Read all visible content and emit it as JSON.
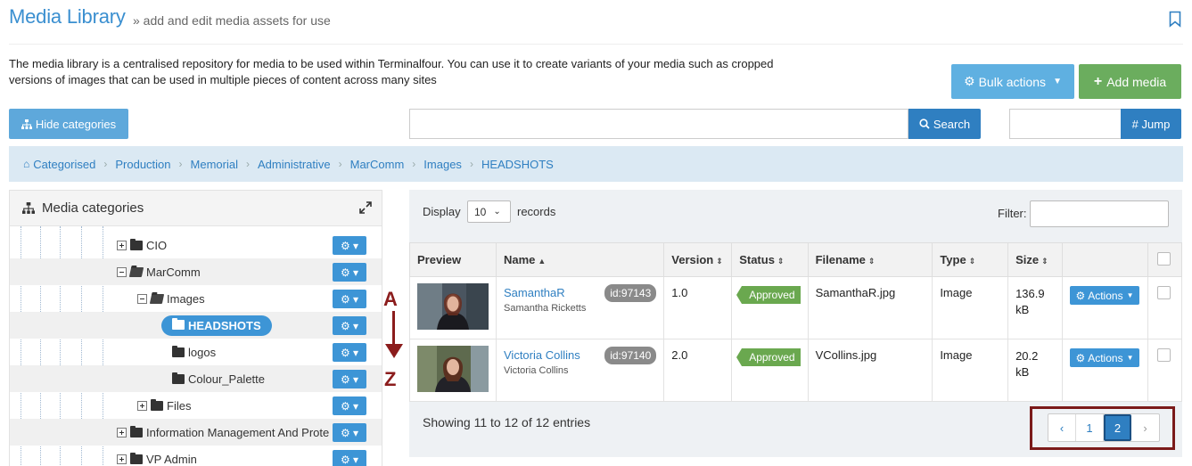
{
  "header": {
    "title": "Media Library",
    "subtitle": "» add and edit media assets for use",
    "intro_line1": "The media library is a centralised repository for media to be used within Terminalfour. You can use it to create variants of your media such as cropped",
    "intro_line2": "versions of images that can be used in multiple pieces of content across many sites"
  },
  "toolbar": {
    "bulk_actions": "Bulk actions",
    "add_media": "Add media",
    "hide_categories": "Hide categories",
    "search": "Search",
    "jump": "# Jump",
    "search_value": "",
    "jump_value": ""
  },
  "breadcrumb": [
    "Categorised",
    "Production",
    "Memorial",
    "Administrative",
    "MarComm",
    "Images",
    "HEADSHOTS"
  ],
  "categories": {
    "title": "Media categories",
    "nodes": [
      "CIO",
      "MarComm",
      "Images",
      "HEADSHOTS",
      "logos",
      "Colour_Palette",
      "Files",
      "Information Management And Prote",
      "VP Admin"
    ]
  },
  "annotation": {
    "top": "A",
    "bottom": "Z"
  },
  "table_controls": {
    "display_label": "Display",
    "display_value": "10",
    "records_label": "records",
    "filter_label": "Filter:"
  },
  "columns": [
    "Preview",
    "Name",
    "Version",
    "Status",
    "Filename",
    "Type",
    "Size"
  ],
  "rows": [
    {
      "name": "SamanthaR",
      "subname": "Samantha Ricketts",
      "id": "id:97143",
      "version": "1.0",
      "status": "Approved",
      "filename": "SamanthaR.jpg",
      "type": "Image",
      "size": "136.9 kB",
      "actions": "Actions"
    },
    {
      "name": "Victoria Collins",
      "subname": "Victoria Collins",
      "id": "id:97140",
      "version": "2.0",
      "status": "Approved",
      "filename": "VCollins.jpg",
      "type": "Image",
      "size": "20.2 kB",
      "actions": "Actions"
    }
  ],
  "footer": {
    "showing": "Showing 11 to 12 of 12 entries",
    "pages": [
      "‹",
      "1",
      "2",
      "›"
    ]
  },
  "colors": {
    "primary": "#2f7fc1",
    "accent": "#3d95d6",
    "success": "#6bad5e",
    "annotation": "#8b1c1c"
  }
}
